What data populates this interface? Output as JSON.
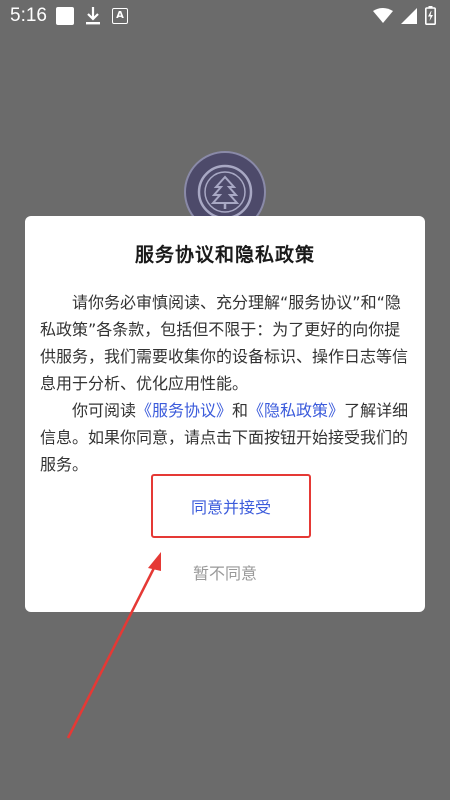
{
  "status_bar": {
    "time": "5:16",
    "icons": [
      "notification-square-icon",
      "download-icon",
      "a-box-icon",
      "wifi-icon",
      "cellular-signal-icon",
      "battery-icon"
    ],
    "a_glyph": "A"
  },
  "background": {
    "logo_icon": "app-logo-icon"
  },
  "dialog": {
    "title": "服务协议和隐私政策",
    "para1": "请你务必审慎阅读、充分理解“服务协议”和“隐私政策”各条款，包括但不限于：为了更好的向你提供服务，我们需要收集你的设备标识、操作日志等信息用于分析、优化应用性能。",
    "para2_prefix": "你可阅读",
    "service_link": "《服务协议》",
    "para2_and": "和",
    "privacy_link": "《隐私政策》",
    "para2_suffix": "了解详细信息。如果你同意，请点击下面按钮开始接受我们的服务。",
    "accept_label": "同意并接受",
    "decline_label": "暂不同意"
  },
  "colors": {
    "accent": "#3b5bdb",
    "annotation": "#e53935",
    "overlay": "#6b6b6b"
  }
}
